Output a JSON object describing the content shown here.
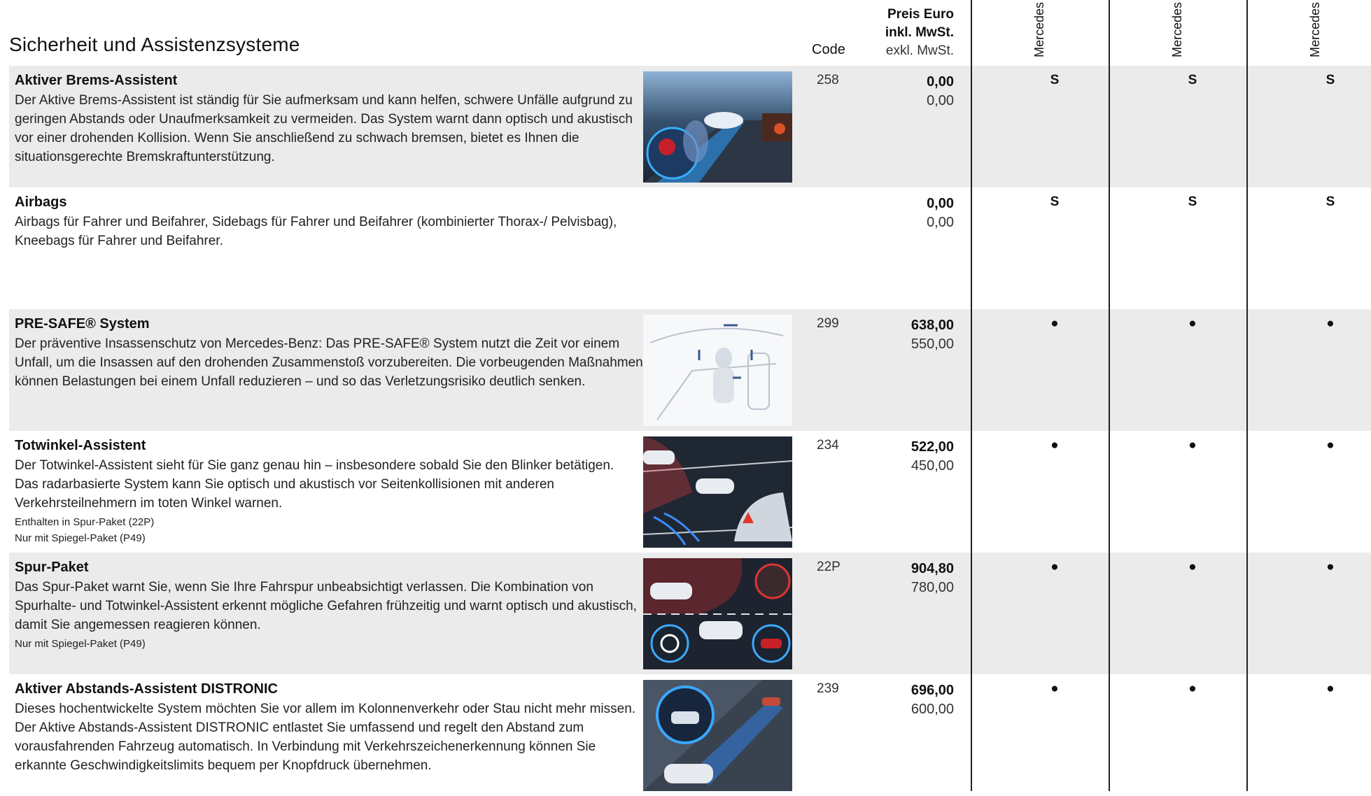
{
  "section_title": "Sicherheit und Assistenzsysteme",
  "headers": {
    "code": "Code",
    "price_line1": "Preis Euro",
    "price_line2": "inkl. MwSt.",
    "price_line3": "exkl. MwSt.",
    "models": [
      "Mercedes",
      "Mercedes",
      "Mercedes"
    ]
  },
  "rows": [
    {
      "title": "Aktiver Brems-Assistent",
      "description": "Der Aktive Brems-Assistent ist ständig für Sie aufmerksam und kann helfen, schwere Unfälle aufgrund zu geringen Abstands oder Unaufmerksamkeit zu vermeiden. Das System warnt dann optisch und akustisch vor einer drohenden Kollision. Wenn Sie anschließend zu schwach bremsen, bietet es Ihnen die situationsgerechte Bremskraftunterstützung.",
      "notes": [],
      "code": "258",
      "price_inkl": "0,00",
      "price_exkl": "0,00",
      "availability": [
        "S",
        "S",
        "S"
      ]
    },
    {
      "title": "Airbags",
      "description": "Airbags für Fahrer und Beifahrer, Sidebags für Fahrer und Beifahrer (kombinierter Thorax-/ Pelvisbag), Kneebags für Fahrer und Beifahrer.",
      "notes": [],
      "code": "",
      "price_inkl": "0,00",
      "price_exkl": "0,00",
      "availability": [
        "S",
        "S",
        "S"
      ]
    },
    {
      "title": "PRE-SAFE® System",
      "description": "Der präventive Insassenschutz von Mercedes-Benz: Das PRE-SAFE® System nutzt die Zeit vor einem Unfall, um die Insassen auf den drohenden Zusammenstoß vorzubereiten. Die vorbeugenden Maßnahmen können Belastungen bei einem Unfall reduzieren – und so das Verletzungsrisiko deutlich senken.",
      "notes": [],
      "code": "299",
      "price_inkl": "638,00",
      "price_exkl": "550,00",
      "availability": [
        "●",
        "●",
        "●"
      ]
    },
    {
      "title": "Totwinkel-Assistent",
      "description": "Der Totwinkel-Assistent sieht für Sie ganz genau hin – insbesondere sobald Sie den Blinker betätigen. Das radarbasierte System kann Sie optisch und akustisch vor Seitenkollisionen mit anderen Verkehrsteilnehmern im toten Winkel warnen.",
      "notes": [
        "Enthalten in Spur-Paket (22P)",
        "Nur mit Spiegel-Paket (P49)"
      ],
      "code": "234",
      "price_inkl": "522,00",
      "price_exkl": "450,00",
      "availability": [
        "●",
        "●",
        "●"
      ]
    },
    {
      "title": "Spur-Paket",
      "description": "Das Spur-Paket warnt Sie, wenn Sie Ihre Fahrspur unbeabsichtigt verlassen. Die Kombination von Spurhalte- und Totwinkel-Assistent erkennt mögliche Gefahren frühzeitig und warnt optisch und akustisch, damit Sie angemessen reagieren können.",
      "notes": [
        "Nur mit Spiegel-Paket (P49)"
      ],
      "code": "22P",
      "price_inkl": "904,80",
      "price_exkl": "780,00",
      "availability": [
        "●",
        "●",
        "●"
      ]
    },
    {
      "title": "Aktiver Abstands-Assistent DISTRONIC",
      "description": "Dieses hochentwickelte System möchten Sie vor allem im Kolonnenverkehr oder Stau nicht mehr missen. Der Aktive Abstands-Assistent DISTRONIC entlastet Sie umfassend und regelt den Abstand zum vorausfahrenden Fahrzeug automatisch. In Verbindung mit Verkehrszeichenerkennung können Sie erkannte Geschwindigkeitslimits bequem per Knopfdruck übernehmen.",
      "notes": [],
      "code": "239",
      "price_inkl": "696,00",
      "price_exkl": "600,00",
      "availability": [
        "●",
        "●",
        "●"
      ]
    }
  ]
}
